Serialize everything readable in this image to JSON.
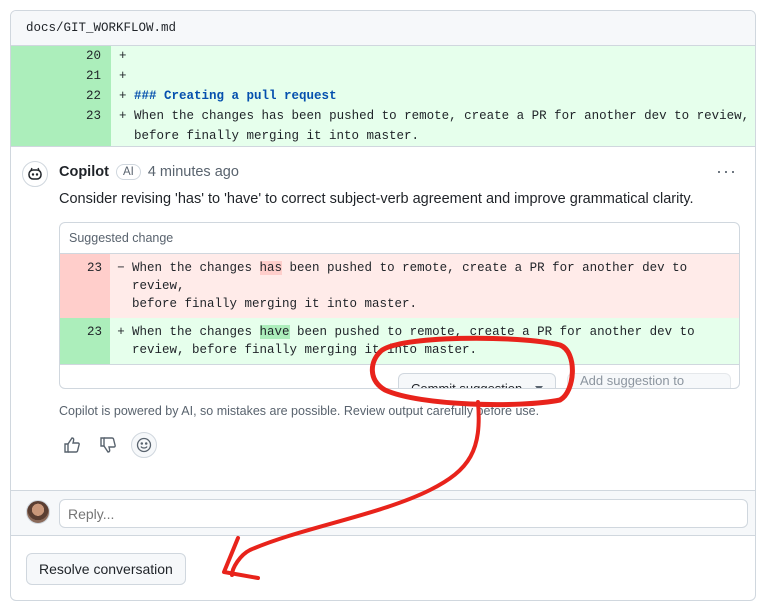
{
  "file": {
    "path": "docs/GIT_WORKFLOW.md"
  },
  "diff_lines": [
    {
      "num": "20",
      "sign": "+",
      "text": ""
    },
    {
      "num": "21",
      "sign": "+",
      "text": ""
    },
    {
      "num": "22",
      "sign": "+",
      "text": "### Creating a pull request"
    },
    {
      "num": "23",
      "sign": "+",
      "text": "When the changes has been pushed to remote, create a PR for another dev to review,\n  before finally merging it into master."
    }
  ],
  "comment": {
    "author": "Copilot",
    "badge": "AI",
    "time": "4 minutes ago",
    "more_icon": "kebab-horizontal-icon",
    "body": "Consider revising 'has' to 'have' to correct subject-verb agreement and improve grammatical clarity."
  },
  "suggestion": {
    "header": "Suggested change",
    "removed": {
      "num": "23",
      "sign": "−",
      "before": "When the changes ",
      "word": "has",
      "after": " been pushed to remote, create a PR for another dev to review,\nbefore finally merging it into master."
    },
    "added": {
      "num": "23",
      "sign": "+",
      "before": "When the changes ",
      "word": "have",
      "after": " been pushed to remote, create a PR for another dev to\nreview, before finally merging it into master."
    },
    "commit_label": "Commit suggestion",
    "batch_label": "Add suggestion to batch"
  },
  "disclaimer": "Copilot is powered by AI, so mistakes are possible. Review output carefully before use.",
  "reply": {
    "placeholder": "Reply..."
  },
  "resolve_label": "Resolve conversation",
  "colors": {
    "annotation": "#e8231b",
    "added_bg": "#e6ffec",
    "removed_bg": "#ffebe9"
  }
}
